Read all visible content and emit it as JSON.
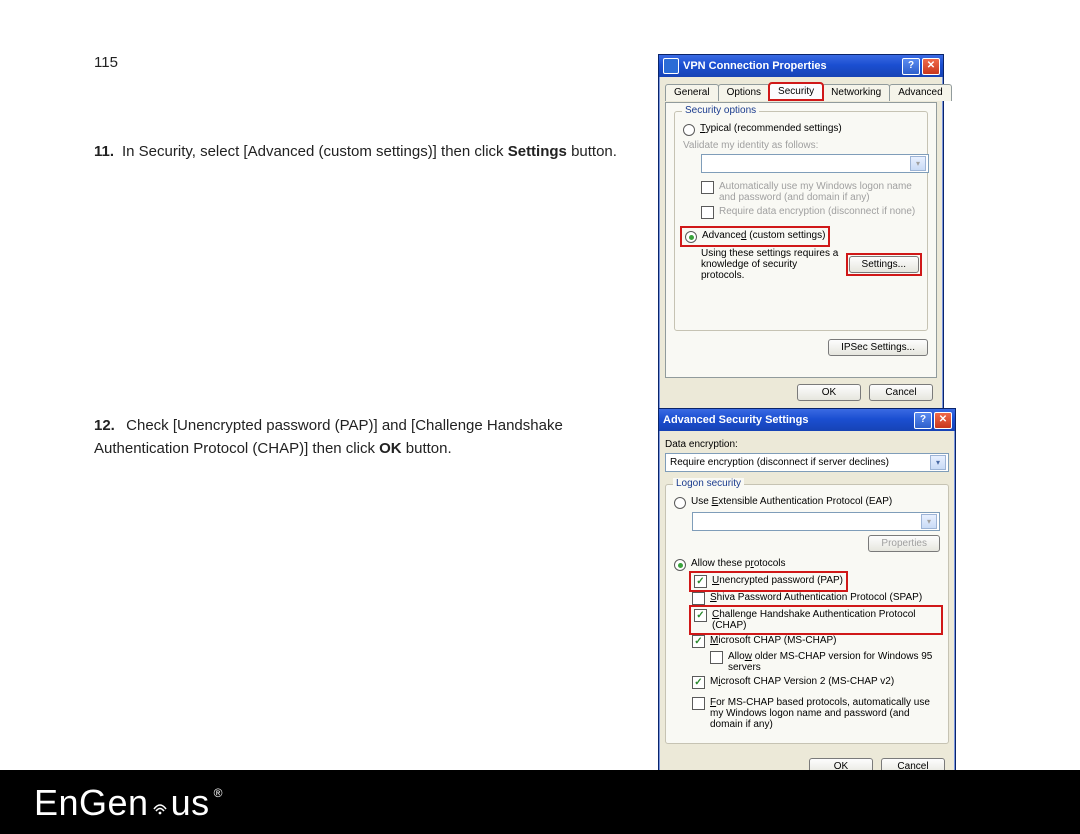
{
  "page_number": "115",
  "steps": {
    "s11": {
      "num": "11.",
      "before": "In Security, select [Advanced (custom settings)] then click ",
      "bold": "Settings",
      "after": " button."
    },
    "s12": {
      "num": "12.",
      "before": " Check [Unencrypted password (PAP)] and [Challenge Handshake Authentication Protocol (CHAP)] then click ",
      "bold": "OK",
      "after": " button."
    }
  },
  "brand": "EnGenius",
  "dlg1": {
    "title": "VPN Connection Properties",
    "tabs": [
      "General",
      "Options",
      "Security",
      "Networking",
      "Advanced"
    ],
    "active_tab": 2,
    "group": "Security options",
    "typical": "Typical (recommended settings)",
    "validate": "Validate my identity as follows:",
    "autologon": "Automatically use my Windows logon name and password (and domain if any)",
    "require_enc": "Require data encryption (disconnect if none)",
    "advanced": "Advanced (custom settings)",
    "adv_hint": "Using these settings requires a knowledge of security protocols.",
    "settings_btn": "Settings...",
    "ipsec_btn": "IPSec Settings...",
    "ok": "OK",
    "cancel": "Cancel"
  },
  "dlg2": {
    "title": "Advanced Security Settings",
    "data_enc_label": "Data encryption:",
    "data_enc_value": "Require encryption (disconnect if server declines)",
    "group": "Logon security",
    "use_eap": "Use Extensible Authentication Protocol (EAP)",
    "properties": "Properties",
    "allow": "Allow these protocols",
    "pap": "Unencrypted password (PAP)",
    "spap": "Shiva Password Authentication Protocol (SPAP)",
    "chap": "Challenge Handshake Authentication Protocol (CHAP)",
    "mschap": "Microsoft CHAP (MS-CHAP)",
    "mschap_old": "Allow older MS-CHAP version for Windows 95 servers",
    "mschap2": "Microsoft CHAP Version 2 (MS-CHAP v2)",
    "mschap_auto": "For MS-CHAP based protocols, automatically use my Windows logon name and password (and domain if any)",
    "ok": "OK",
    "cancel": "Cancel"
  }
}
